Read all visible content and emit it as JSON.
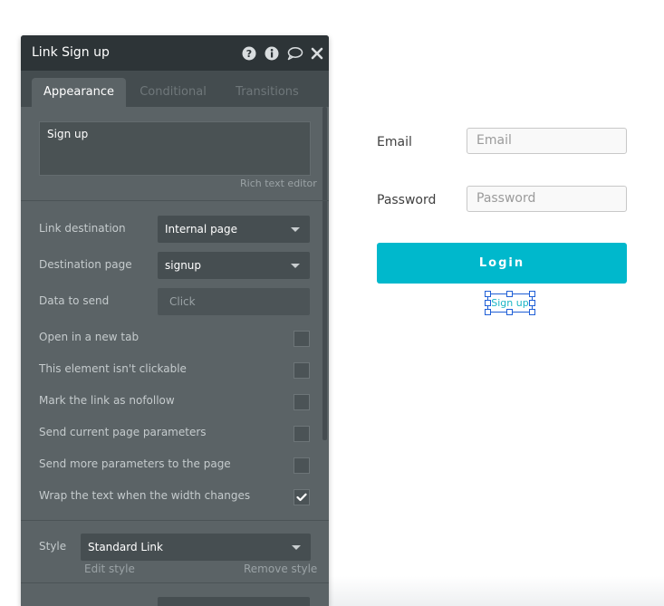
{
  "panel": {
    "title": "Link Sign up",
    "header_icons": [
      "help-icon",
      "info-icon",
      "comment-icon",
      "close-icon"
    ],
    "tabs": [
      {
        "label": "Appearance",
        "active": true
      },
      {
        "label": "Conditional",
        "active": false
      },
      {
        "label": "Transitions",
        "active": false
      }
    ],
    "rich_text": {
      "value": "Sign up",
      "editor_link": "Rich text editor"
    },
    "link_destination": {
      "label": "Link destination",
      "value": "Internal page"
    },
    "destination_page": {
      "label": "Destination page",
      "value": "signup"
    },
    "data_to_send": {
      "label": "Data to send",
      "placeholder": "Click"
    },
    "checkboxes": [
      {
        "label": "Open in a new tab",
        "checked": false
      },
      {
        "label": "This element isn't clickable",
        "checked": false
      },
      {
        "label": "Mark the link as nofollow",
        "checked": false
      },
      {
        "label": "Send current page parameters",
        "checked": false
      },
      {
        "label": "Send more parameters to the page",
        "checked": false
      },
      {
        "label": "Wrap the text when the width changes",
        "checked": true
      }
    ],
    "style": {
      "label": "Style",
      "value": "Standard Link",
      "edit_link": "Edit style",
      "remove_link": "Remove style"
    }
  },
  "canvas": {
    "email_label": "Email",
    "email_placeholder": "Email",
    "password_label": "Password",
    "password_placeholder": "Password",
    "login_button": "Login",
    "signup_link": "Sign up"
  },
  "colors": {
    "panel_bg": "#5b6366",
    "panel_header": "#2d3437",
    "accent": "#00b8cc",
    "selection": "#1f5fd6"
  }
}
